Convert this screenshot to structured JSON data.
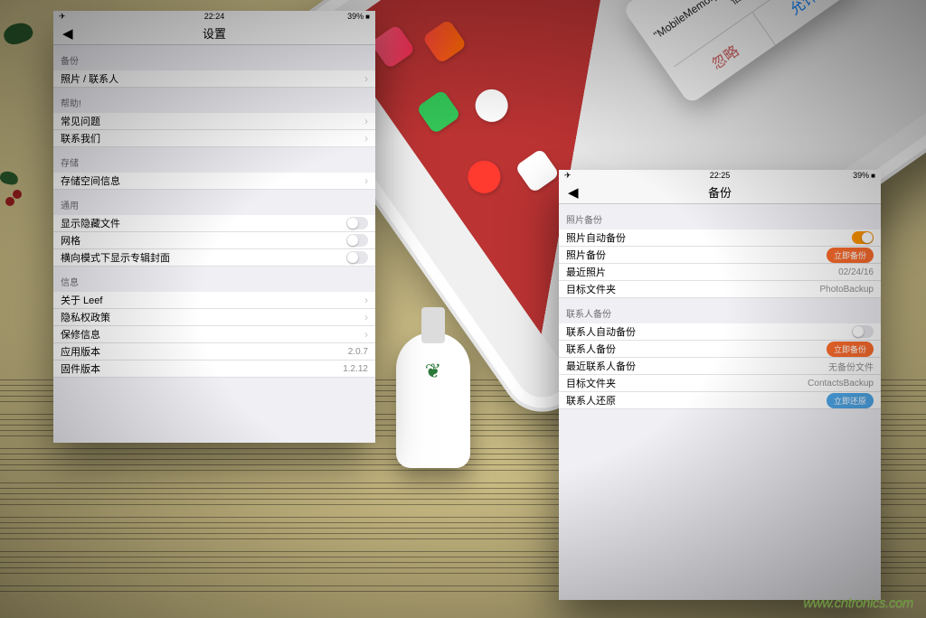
{
  "watermark": "www.cntronics.com",
  "ipad_alert": {
    "title": "MobileMemory",
    "body": "\"MobileMemory\" 想与 Leef\"iAccess\" 通信。",
    "cancel": "忽略",
    "ok": "允许"
  },
  "left_panel": {
    "status": {
      "time": "22:24",
      "battery": "39%"
    },
    "nav_title": "设置",
    "sections": [
      {
        "header": "备份",
        "cells": [
          {
            "label": "照片 / 联系人",
            "accessory": "chevron"
          }
        ]
      },
      {
        "header": "帮助!",
        "cells": [
          {
            "label": "常见问题",
            "accessory": "chevron"
          },
          {
            "label": "联系我们",
            "accessory": "chevron"
          }
        ]
      },
      {
        "header": "存储",
        "cells": [
          {
            "label": "存储空间信息",
            "accessory": "chevron"
          }
        ]
      },
      {
        "header": "通用",
        "cells": [
          {
            "label": "显示隐藏文件",
            "accessory": "switch"
          },
          {
            "label": "网格",
            "accessory": "switch"
          },
          {
            "label": "横向模式下显示专辑封面",
            "accessory": "switch"
          }
        ]
      },
      {
        "header": "信息",
        "cells": [
          {
            "label": "关于 Leef",
            "accessory": "chevron"
          },
          {
            "label": "隐私权政策",
            "accessory": "chevron"
          },
          {
            "label": "保修信息",
            "accessory": "chevron"
          },
          {
            "label": "应用版本",
            "value": "2.0.7"
          },
          {
            "label": "固件版本",
            "value": "1.2.12"
          }
        ]
      }
    ]
  },
  "right_panel": {
    "status": {
      "time": "22:25",
      "battery": "39%"
    },
    "nav_title": "备份",
    "sections": [
      {
        "header": "照片备份",
        "cells": [
          {
            "label": "照片自动备份",
            "accessory": "switch_on"
          },
          {
            "label": "照片备份",
            "accessory": "pill_orange",
            "pill_label": "立即备份"
          },
          {
            "label": "最近照片",
            "value": "02/24/16"
          },
          {
            "label": "目标文件夹",
            "value": "PhotoBackup"
          }
        ]
      },
      {
        "header": "联系人备份",
        "cells": [
          {
            "label": "联系人自动备份",
            "accessory": "switch"
          },
          {
            "label": "联系人备份",
            "accessory": "pill_orange",
            "pill_label": "立即备份"
          },
          {
            "label": "最近联系人备份",
            "value": "无备份文件"
          },
          {
            "label": "目标文件夹",
            "value": "ContactsBackup"
          },
          {
            "label": "联系人还原",
            "accessory": "pill_blue",
            "pill_label": "立即还原"
          }
        ]
      }
    ]
  }
}
